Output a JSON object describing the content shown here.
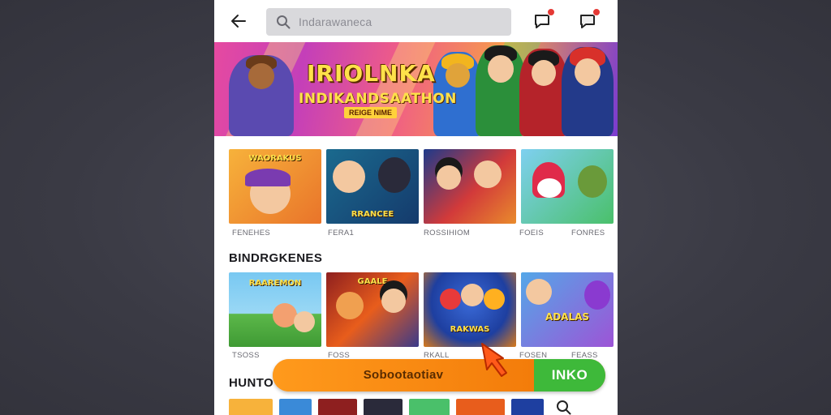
{
  "search": {
    "placeholder": "Indarawaneca"
  },
  "banner": {
    "title": "IRIOLNKA",
    "subtitle": "INDIKANDSAATHON",
    "tag": "REIGE NIME"
  },
  "featured": {
    "cards": [
      {
        "label": "FENEHES",
        "caption": "WAORAKUS",
        "color_a": "#f7b23b",
        "color_b": "#e9742a"
      },
      {
        "label": "FERA1",
        "caption": "RRANCEE",
        "color_a": "#1b6a8e",
        "color_b": "#143a6c"
      },
      {
        "label": "ROSSIHIOM",
        "caption": "",
        "color_a": "#d23a3a",
        "color_b": "#e98b2c"
      },
      {
        "label": "FOEIS",
        "caption": "",
        "color_a": "#7ed0f0",
        "color_b": "#4ac06a"
      }
    ],
    "extra_labels": [
      "FONRES"
    ]
  },
  "section2": {
    "heading": "BINDRGKENES",
    "cards": [
      {
        "label": "TSOSS",
        "caption": "RAAREMON",
        "color_a": "#78c8f2",
        "color_b": "#5cb84a"
      },
      {
        "label": "FOSS",
        "caption": "GAALE",
        "color_a": "#8e1f1f",
        "color_b": "#e85d1c"
      },
      {
        "label": "RKALL",
        "caption": "RAKWAS",
        "color_a": "#1e3fa0",
        "color_b": "#d97a1a"
      },
      {
        "label": "FOSEN",
        "caption": "ADALAS",
        "color_a": "#54a7e8",
        "color_b": "#9d54d6"
      }
    ],
    "extra_labels": [
      "FEASS"
    ]
  },
  "section3": {
    "heading": "HUNTO"
  },
  "cta": {
    "left_label": "Sobootaotiav",
    "right_label": "INKO"
  },
  "colors": {
    "cta_orange": "#f88a12",
    "cta_green": "#3eb93a",
    "badge": "#e53935"
  }
}
